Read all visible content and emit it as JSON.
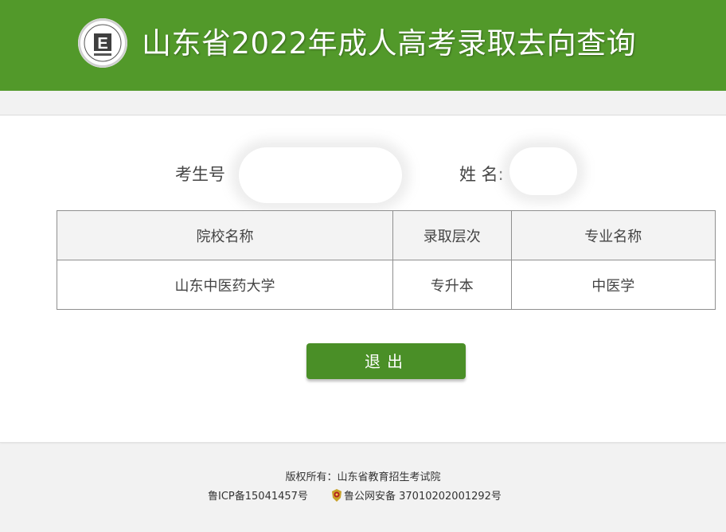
{
  "header": {
    "title": "山东省2022年成人高考录取去向查询",
    "logo_letter": "E",
    "logo_icon": "school-seal-logo",
    "background_color": "#52992a"
  },
  "query": {
    "exam_id_label": "考生号",
    "name_label": "姓 名:"
  },
  "table": {
    "headers": [
      "院校名称",
      "录取层次",
      "专业名称"
    ],
    "rows": [
      [
        "山东中医药大学",
        "专升本",
        "中医学"
      ]
    ]
  },
  "actions": {
    "exit_label": "退出",
    "exit_color": "#4a8f27"
  },
  "footer": {
    "copyright": "版权所有：山东省教育招生考试院",
    "icp": "鲁ICP备15041457号",
    "police_record": "鲁公网安备 37010202001292号",
    "police_icon": "police-badge-icon"
  }
}
